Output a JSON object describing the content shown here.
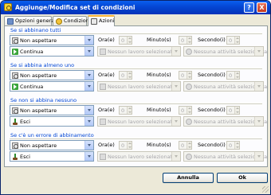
{
  "window": {
    "title": "Aggiunge/Modifica set di condizioni",
    "help_label": "?",
    "close_label": "X"
  },
  "tabs": [
    {
      "label": "Opzioni generali"
    },
    {
      "label": "Condizioni"
    },
    {
      "label": "Azioni",
      "active": true
    }
  ],
  "labels": {
    "hours": "Ora(e)",
    "minutes": "Minuto(s)",
    "seconds": "Secondo(i)"
  },
  "groups": [
    {
      "title": "Se si abbinano tutti",
      "wait_value": "Non aspettare",
      "action_value": "Continua",
      "hours": "0",
      "minutes": "0",
      "seconds": "0",
      "job_placeholder": "Nessun lavoro selezionato",
      "activity_placeholder": "Nessuna attività selezionata"
    },
    {
      "title": "Se si abbina almeno uno",
      "wait_value": "Non aspettare",
      "action_value": "Continua",
      "hours": "0",
      "minutes": "0",
      "seconds": "0",
      "job_placeholder": "Nessun lavoro selezionato",
      "activity_placeholder": "Nessuna attività selezionata"
    },
    {
      "title": "Se non si abbina nessuno",
      "wait_value": "Non aspettare",
      "action_value": "Esci",
      "hours": "0",
      "minutes": "0",
      "seconds": "0",
      "job_placeholder": "Nessun lavoro selezionato",
      "activity_placeholder": "Nessuna attività selezionata"
    },
    {
      "title": "Se c'è un errore di abbinamento",
      "wait_value": "Non aspettare",
      "action_value": "Esci",
      "hours": "0",
      "minutes": "0",
      "seconds": "0",
      "job_placeholder": "Nessun lavoro selezionato",
      "activity_placeholder": "Nessuna attività selezionata"
    }
  ],
  "buttons": {
    "cancel": "Annulla",
    "ok": "Ok"
  },
  "colors": {
    "title_bar": "#0548d6",
    "group_title": "#0046d5",
    "active_tab_accent": "#f7b43a"
  }
}
